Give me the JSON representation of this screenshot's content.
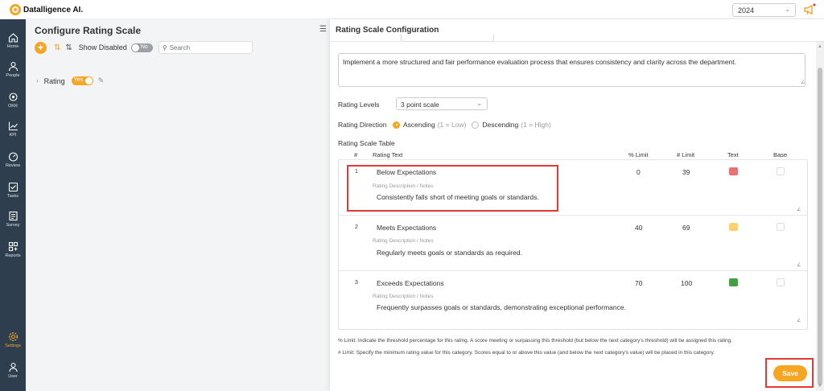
{
  "brand": {
    "name": "Datalligence AI."
  },
  "header": {
    "year": "2024"
  },
  "sidebar": {
    "items": [
      {
        "label": "Home",
        "icon": "home-icon"
      },
      {
        "label": "People",
        "icon": "people-icon"
      },
      {
        "label": "OKR",
        "icon": "target-icon"
      },
      {
        "label": "KPI",
        "icon": "chart-icon"
      },
      {
        "label": "Review",
        "icon": "gauge-icon"
      },
      {
        "label": "Tasks",
        "icon": "checkbox-icon"
      },
      {
        "label": "Survey",
        "icon": "survey-icon"
      },
      {
        "label": "Reports",
        "icon": "reports-icon"
      },
      {
        "label": "Settings",
        "icon": "gear-icon",
        "active": true
      },
      {
        "label": "User",
        "icon": "user-icon"
      }
    ]
  },
  "left": {
    "title": "Configure Rating Scale",
    "show_disabled_label": "Show Disabled",
    "show_disabled_toggle": "No",
    "search_placeholder": "Search",
    "rating_item": {
      "label": "Rating",
      "toggle": "Yes"
    }
  },
  "panel": {
    "title": "Rating Scale Configuration",
    "objective_text": "Implement a more structured and fair performance evaluation process that ensures consistency and clarity across the department.",
    "rating_levels_label": "Rating Levels",
    "rating_levels_value": "3 point scale",
    "rating_direction_label": "Rating Direction",
    "direction_options": [
      {
        "label": "Ascending",
        "hint": "(1 = Low)",
        "checked": true
      },
      {
        "label": "Descending",
        "hint": "(1 = High)",
        "checked": false
      }
    ],
    "table_title": "Rating Scale Table",
    "columns": {
      "num": "#",
      "text": "Rating Text",
      "pct": "% Limit",
      "num_limit": "# Limit",
      "color": "Text",
      "base": "Base"
    },
    "desc_label": "Rating Description / Notes",
    "rows": [
      {
        "idx": "1",
        "text": "Below Expectations",
        "pct": "0",
        "num": "39",
        "color": "#e57373",
        "desc": "Consistently falls short of meeting goals or standards."
      },
      {
        "idx": "2",
        "text": "Meets Expectations",
        "pct": "40",
        "num": "69",
        "color": "#ffd270",
        "desc": "Regularly meets goals or standards as required."
      },
      {
        "idx": "3",
        "text": "Exceeds Expectations",
        "pct": "70",
        "num": "100",
        "color": "#43a047",
        "desc": "Frequently surpasses goals or standards, demonstrating exceptional performance."
      }
    ],
    "note_pct": "% Limit: Indicate the threshold percentage for this rating. A score meeting or surpassing this threshold (but below the next category's threshold) will be assigned this rating.",
    "note_num": "# Limit: Specify the minimum rating value for this category. Scores equal to or above this value (and below the next category's value) will be placed in this category.",
    "save_label": "Save"
  },
  "colors": {
    "accent": "#f5a623",
    "sidebar": "#2e3e4e",
    "highlight": "#e53935"
  }
}
